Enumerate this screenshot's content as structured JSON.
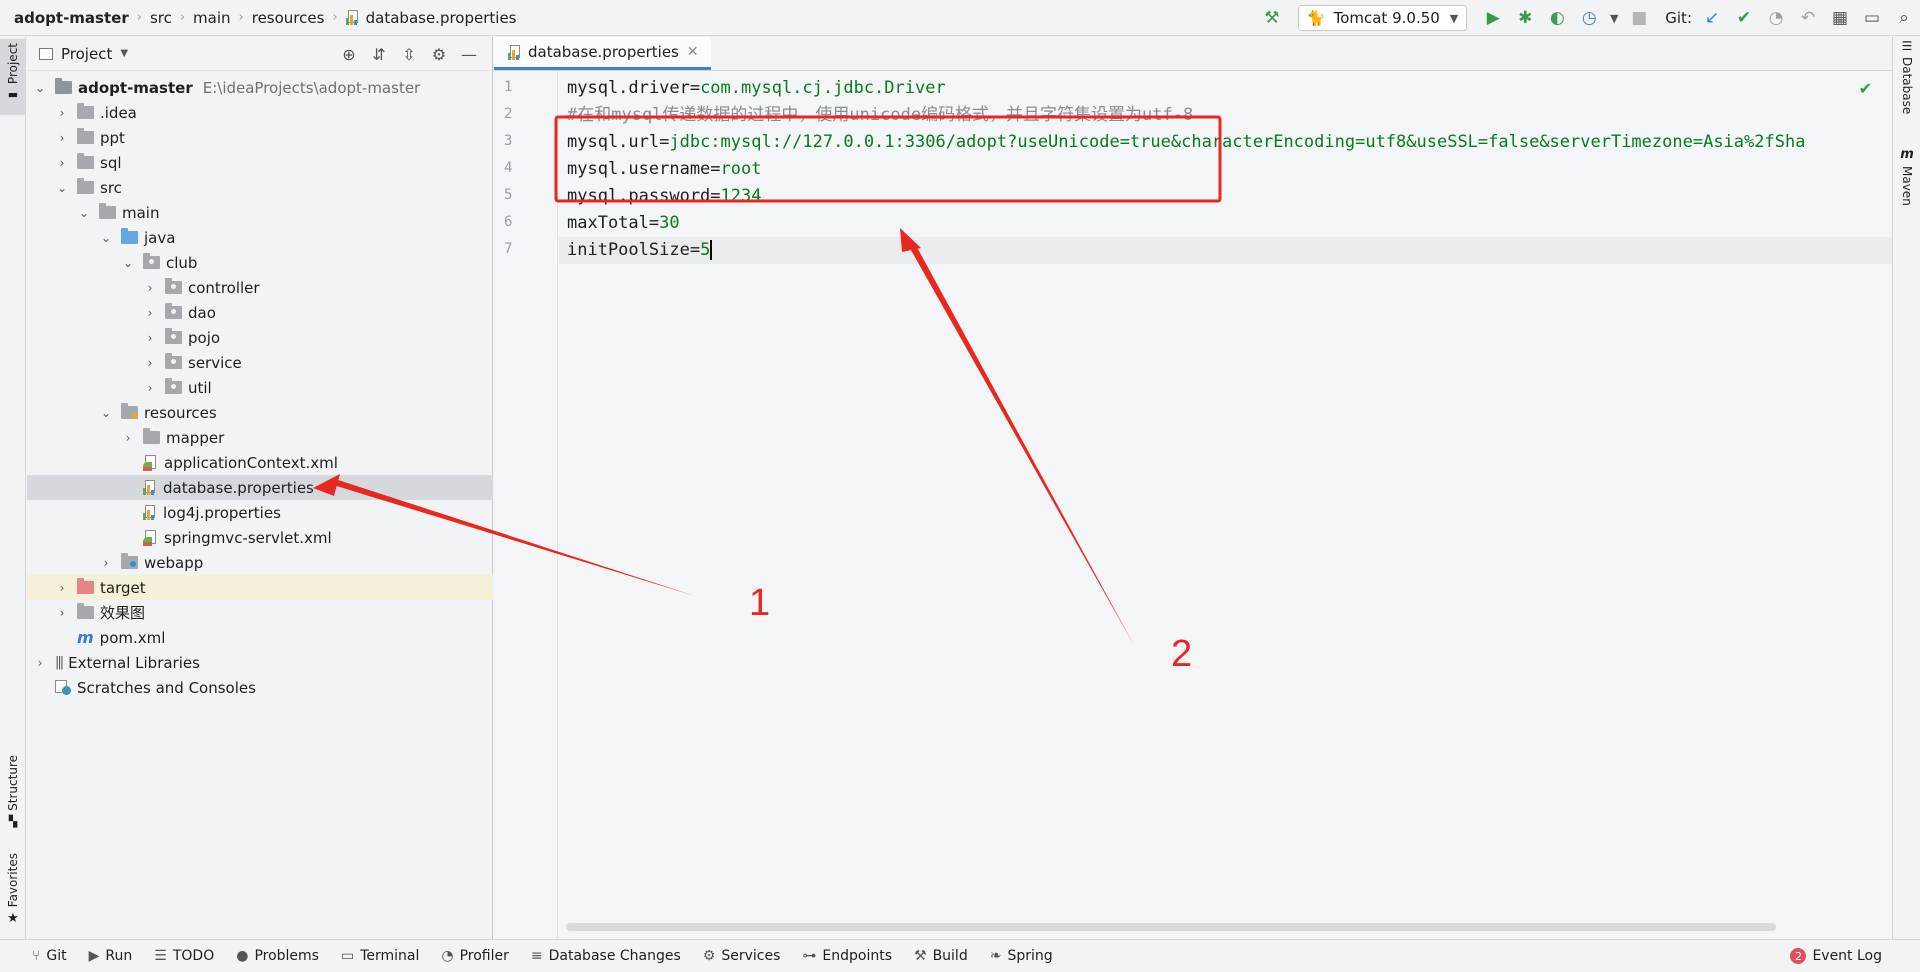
{
  "breadcrumbs": [
    "adopt-master",
    "src",
    "main",
    "resources",
    "database.properties"
  ],
  "toolbar": {
    "run_config": "Tomcat 9.0.50",
    "git_label": "Git:"
  },
  "left_strip": {
    "project": "Project",
    "structure": "Structure",
    "favorites": "Favorites"
  },
  "right_strip": {
    "database": "Database",
    "maven": "Maven"
  },
  "project_panel": {
    "title": "Project",
    "root_name": "adopt-master",
    "root_path": "E:\\ideaProjects\\adopt-master",
    "items": [
      {
        "label": "adopt-master",
        "icon": "module-folder-icon",
        "depth": 0,
        "chevron": "open"
      },
      {
        "label": ".idea",
        "icon": "folder-icon",
        "depth": 1,
        "chevron": "closed"
      },
      {
        "label": "ppt",
        "icon": "folder-icon",
        "depth": 1,
        "chevron": "closed"
      },
      {
        "label": "sql",
        "icon": "folder-icon",
        "depth": 1,
        "chevron": "closed"
      },
      {
        "label": "src",
        "icon": "folder-icon",
        "depth": 1,
        "chevron": "open"
      },
      {
        "label": "main",
        "icon": "folder-icon",
        "depth": 2,
        "chevron": "open"
      },
      {
        "label": "java",
        "icon": "source-folder-icon",
        "depth": 3,
        "chevron": "open"
      },
      {
        "label": "club",
        "icon": "package-icon",
        "depth": 4,
        "chevron": "open"
      },
      {
        "label": "controller",
        "icon": "package-icon",
        "depth": 5,
        "chevron": "closed"
      },
      {
        "label": "dao",
        "icon": "package-icon",
        "depth": 5,
        "chevron": "closed"
      },
      {
        "label": "pojo",
        "icon": "package-icon",
        "depth": 5,
        "chevron": "closed"
      },
      {
        "label": "service",
        "icon": "package-icon",
        "depth": 5,
        "chevron": "closed"
      },
      {
        "label": "util",
        "icon": "package-icon",
        "depth": 5,
        "chevron": "closed"
      },
      {
        "label": "resources",
        "icon": "resources-folder-icon",
        "depth": 3,
        "chevron": "open"
      },
      {
        "label": "mapper",
        "icon": "folder-icon",
        "depth": 4,
        "chevron": "closed"
      },
      {
        "label": "applicationContext.xml",
        "icon": "spring-xml-icon",
        "depth": 4,
        "chevron": "none"
      },
      {
        "label": "database.properties",
        "icon": "properties-file-icon",
        "depth": 4,
        "chevron": "none",
        "selected": true
      },
      {
        "label": "log4j.properties",
        "icon": "properties-file-icon",
        "depth": 4,
        "chevron": "none"
      },
      {
        "label": "springmvc-servlet.xml",
        "icon": "spring-xml-icon",
        "depth": 4,
        "chevron": "none"
      },
      {
        "label": "webapp",
        "icon": "web-folder-icon",
        "depth": 3,
        "chevron": "closed"
      },
      {
        "label": "target",
        "icon": "excluded-folder-icon",
        "depth": 1,
        "chevron": "closed",
        "highlight": true
      },
      {
        "label": "效果图",
        "icon": "folder-icon",
        "depth": 1,
        "chevron": "closed"
      },
      {
        "label": "pom.xml",
        "icon": "maven-icon",
        "depth": 1,
        "chevron": "none"
      },
      {
        "label": "External Libraries",
        "icon": "libraries-icon",
        "depth": 0,
        "chevron": "closed"
      },
      {
        "label": "Scratches and Consoles",
        "icon": "scratches-icon",
        "depth": 0,
        "chevron": "none"
      }
    ]
  },
  "editor": {
    "tab": "database.properties",
    "lines": [
      {
        "n": "1",
        "key": "mysql.driver=",
        "val": "com.mysql.cj.jdbc.Driver"
      },
      {
        "n": "2",
        "comment": "#在和mysql传递数据的过程中，使用unicode编码格式，并且字符集设置为utf-8"
      },
      {
        "n": "3",
        "key": "mysql.url=",
        "val": "jdbc:mysql://127.0.0.1:3306/adopt?useUnicode=true&characterEncoding=utf8&useSSL=false&serverTimezone=Asia%2fSha"
      },
      {
        "n": "4",
        "key": "mysql.username=",
        "val": "root"
      },
      {
        "n": "5",
        "key": "mysql.password=",
        "val": "1234"
      },
      {
        "n": "6",
        "key": "maxTotal=",
        "val": "30"
      },
      {
        "n": "7",
        "key": "initPoolSize=",
        "val": "5"
      }
    ]
  },
  "status_bar": {
    "items": [
      {
        "label": "Git",
        "icon": "git-icon"
      },
      {
        "label": "Run",
        "icon": "run-icon"
      },
      {
        "label": "TODO",
        "icon": "todo-icon"
      },
      {
        "label": "Problems",
        "icon": "problems-icon"
      },
      {
        "label": "Terminal",
        "icon": "terminal-icon"
      },
      {
        "label": "Profiler",
        "icon": "profiler-icon"
      },
      {
        "label": "Database Changes",
        "icon": "database-changes-icon"
      },
      {
        "label": "Services",
        "icon": "services-icon"
      },
      {
        "label": "Endpoints",
        "icon": "endpoints-icon"
      },
      {
        "label": "Build",
        "icon": "build-icon"
      },
      {
        "label": "Spring",
        "icon": "spring-icon"
      }
    ],
    "event_log": "Event Log",
    "event_count": "2"
  },
  "annotations": {
    "label_1": "1",
    "label_2": "2",
    "color": "#e8281f"
  }
}
